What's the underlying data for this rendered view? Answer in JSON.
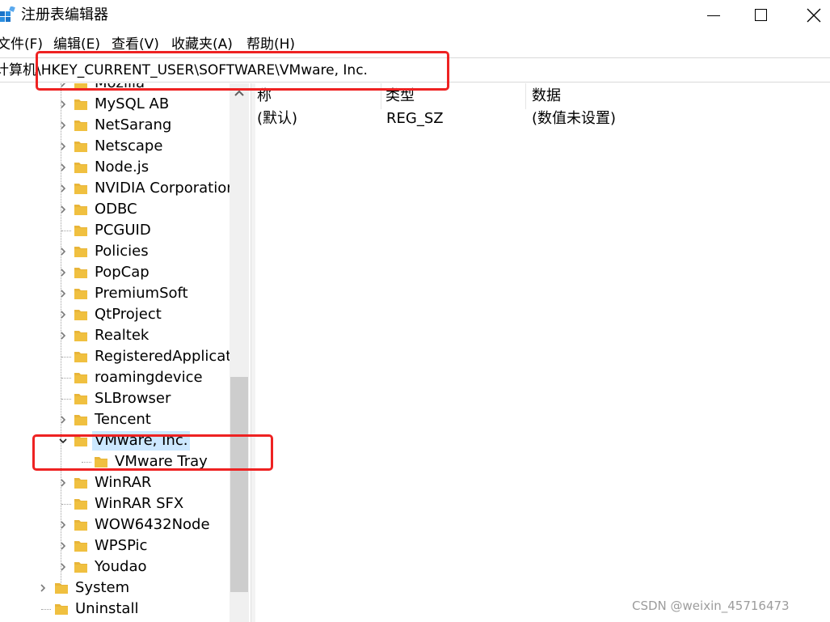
{
  "window": {
    "title": "注册表编辑器",
    "icon": "regedit-icon",
    "controls": [
      "minimize-icon",
      "maximize-icon",
      "close-icon"
    ]
  },
  "menu": [
    {
      "label": "文件(F)"
    },
    {
      "label": "编辑(E)"
    },
    {
      "label": "查看(V)"
    },
    {
      "label": "收藏夹(A)"
    },
    {
      "label": "帮助(H)"
    }
  ],
  "address": {
    "path": "计算机\\HKEY_CURRENT_USER\\SOFTWARE\\VMware, Inc."
  },
  "tree": {
    "items": [
      {
        "label": "Mozilla",
        "expander": "collapsed"
      },
      {
        "label": "MySQL AB",
        "expander": "collapsed"
      },
      {
        "label": "NetSarang",
        "expander": "collapsed"
      },
      {
        "label": "Netscape",
        "expander": "collapsed"
      },
      {
        "label": "Node.js",
        "expander": "collapsed"
      },
      {
        "label": "NVIDIA Corporation",
        "expander": "collapsed"
      },
      {
        "label": "ODBC",
        "expander": "collapsed"
      },
      {
        "label": "PCGUID",
        "expander": "none"
      },
      {
        "label": "Policies",
        "expander": "collapsed"
      },
      {
        "label": "PopCap",
        "expander": "collapsed"
      },
      {
        "label": "PremiumSoft",
        "expander": "collapsed"
      },
      {
        "label": "QtProject",
        "expander": "collapsed"
      },
      {
        "label": "Realtek",
        "expander": "collapsed"
      },
      {
        "label": "RegisteredApplicat",
        "expander": "none"
      },
      {
        "label": "roamingdevice",
        "expander": "none"
      },
      {
        "label": "SLBrowser",
        "expander": "none"
      },
      {
        "label": "Tencent",
        "expander": "collapsed"
      },
      {
        "label": "VMware, Inc.",
        "expander": "expanded",
        "selected": true
      },
      {
        "label": "VMware Tray",
        "expander": "none"
      },
      {
        "label": "WinRAR",
        "expander": "collapsed"
      },
      {
        "label": "WinRAR SFX",
        "expander": "none"
      },
      {
        "label": "WOW6432Node",
        "expander": "collapsed"
      },
      {
        "label": "WPSPic",
        "expander": "collapsed"
      },
      {
        "label": "Youdao",
        "expander": "collapsed"
      },
      {
        "label": "System",
        "expander": "collapsed"
      },
      {
        "label": "Uninstall",
        "expander": "none"
      }
    ]
  },
  "list": {
    "columns": [
      "称",
      "类型",
      "数据"
    ],
    "rows": [
      {
        "name": "(默认)",
        "type": "REG_SZ",
        "data": "(数值未设置)",
        "icon": "string-value-icon"
      }
    ]
  },
  "colors": {
    "highlight_box": "#ee2222",
    "selection": "#cce8ff",
    "folder": "#f0c040"
  },
  "watermark": "CSDN @weixin_45716473"
}
